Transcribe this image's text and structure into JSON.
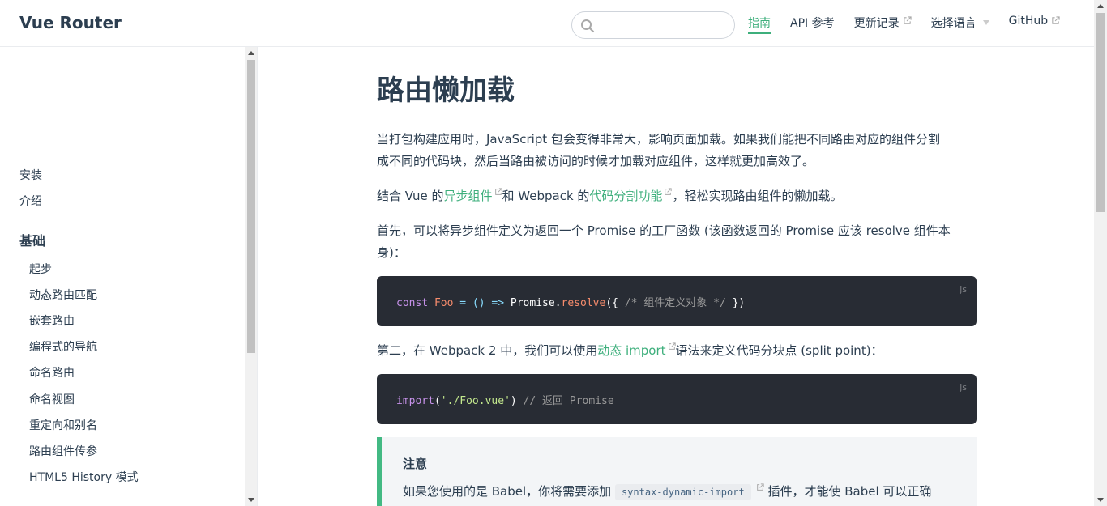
{
  "header": {
    "site_name": "Vue Router",
    "search_placeholder": "",
    "nav": [
      {
        "label": "指南"
      },
      {
        "label": "API 参考"
      },
      {
        "label": "更新记录"
      },
      {
        "label": "选择语言"
      },
      {
        "label": "GitHub"
      }
    ]
  },
  "sidebar": {
    "top_links": [
      "安装",
      "介绍"
    ],
    "group_title": "基础",
    "items": [
      "起步",
      "动态路由匹配",
      "嵌套路由",
      "编程式的导航",
      "命名路由",
      "命名视图",
      "重定向和别名",
      "路由组件传参",
      "HTML5 History 模式"
    ]
  },
  "main": {
    "title": "路由懒加载",
    "p1_line1": "当打包构建应用时，JavaScript 包会变得非常大，影响页面加载。如果我们能把不同路由对应的组件分割",
    "p1_line2": "成不同的代码块，然后当路由被访问的时候才加载对应组件，这样就更加高效了。",
    "p2_before": "结合 Vue 的",
    "p2_link1": "异步组件",
    "p2_mid": "和 Webpack 的",
    "p2_link2": "代码分割功能",
    "p2_after": "，轻松实现路由组件的懒加载。",
    "p3_line1": "首先，可以将异步组件定义为返回一个 Promise 的工厂函数 (该函数返回的 Promise 应该 resolve 组件本",
    "p3_line2": "身)：",
    "code1": {
      "lang": "js",
      "t1": "const",
      "t2": " ",
      "t3": "Foo",
      "t4": " = () => ",
      "t5": "Promise",
      "t6": ".",
      "t7": "resolve",
      "t8": "({ ",
      "t9": "/* 组件定义对象 */",
      "t10": " })"
    },
    "p4_before": "第二，在 Webpack 2 中，我们可以使用",
    "p4_link": "动态 import",
    "p4_after": "语法来定义代码分块点 (split point)：",
    "code2": {
      "lang": "js",
      "t1": "import",
      "t2": "(",
      "t3": "'./Foo.vue'",
      "t4": ") ",
      "t5": "// 返回 Promise"
    },
    "tip": {
      "title": "注意",
      "before": "如果您使用的是 Babel，你将需要添加 ",
      "code": "syntax-dynamic-import",
      "after": " 插件，才能使 Babel 可以正确"
    }
  },
  "colors": {
    "accent": "#3eaf7c",
    "tip_border": "#42b983",
    "code_bg": "#282c34",
    "text": "#2c3e50"
  }
}
